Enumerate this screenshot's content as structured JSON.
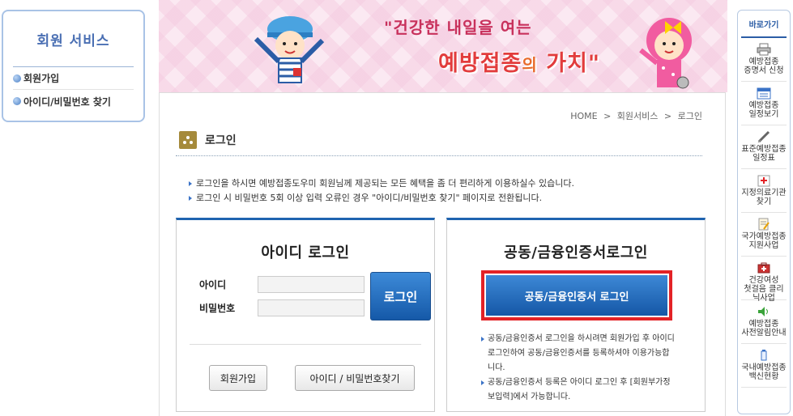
{
  "left_menu": {
    "title": "회원 서비스",
    "items": [
      {
        "label": "회원가입"
      },
      {
        "label": "아이디/비밀번호 찾기"
      }
    ]
  },
  "banner": {
    "line1": "\"건강한 내일을 여는",
    "line2_main": "예방접종",
    "line2_small": "의",
    "line2_end": "가치\""
  },
  "breadcrumb": [
    "HOME",
    "회원서비스",
    "로그인"
  ],
  "page_title": "로그인",
  "notices": [
    "로그인을 하시면 예방접종도우미 회원님께 제공되는 모든 혜택을 좀 더 편리하게 이용하실수 있습니다.",
    "로그인 시 비밀번호 5회 이상 입력 오류인 경우 \"아이디/비밀번호 찾기\" 페이지로 전환됩니다."
  ],
  "id_login": {
    "title": "아이디 로그인",
    "id_label": "아이디",
    "pw_label": "비밀번호",
    "id_value": "",
    "pw_value": "",
    "login_button": "로그인",
    "join_button": "회원가입",
    "find_button": "아이디 / 비밀번호찾기"
  },
  "cert_login": {
    "title": "공동/금융인증서로그인",
    "button": "공동/금융인증서 로그인",
    "notes": [
      "공동/금융인증서 로그인을 하시려면 회원가입 후 아이디 로그인하여 공동/금융인증서를 등록하셔야 이용가능합니다.",
      "공동/금융인증서 등록은 아이디 로그인 후 [회원부가정보입력]에서 가능합니다."
    ]
  },
  "quick_menu": {
    "title": "바로가기",
    "items": [
      {
        "line1": "예방접종",
        "line2": "증명서 신청",
        "icon": "printer-icon"
      },
      {
        "line1": "예방접종",
        "line2": "일정보기",
        "icon": "calendar-icon"
      },
      {
        "line1": "표준예방접종",
        "line2": "일정표",
        "icon": "syringe-icon"
      },
      {
        "line1": "지정의료기관",
        "line2": "찾기",
        "icon": "hospital-icon"
      },
      {
        "line1": "국가예방접종",
        "line2": "지원사업",
        "icon": "document-icon"
      },
      {
        "line1": "건강여성",
        "line2": "첫걸음 클리닉사업",
        "icon": "first-aid-icon"
      },
      {
        "line1": "예방접종",
        "line2": "사전알림안내",
        "icon": "speaker-icon"
      },
      {
        "line1": "국내예방접종",
        "line2": "백신현황",
        "icon": "vaccine-icon"
      }
    ]
  }
}
